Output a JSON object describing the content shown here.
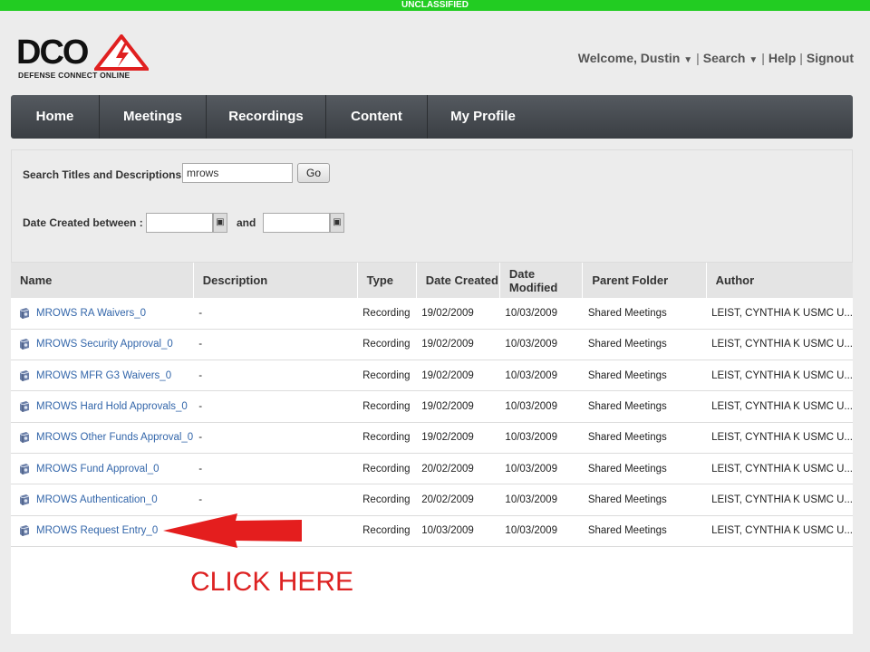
{
  "classification": "UNCLASSIFIED",
  "logo": {
    "title": "DCO",
    "subtitle": "DEFENSE CONNECT ONLINE"
  },
  "topnav": {
    "welcome": "Welcome, Dustin",
    "search": "Search",
    "help": "Help",
    "signout": "Signout"
  },
  "navbar": [
    {
      "label": "Home"
    },
    {
      "label": "Meetings"
    },
    {
      "label": "Recordings"
    },
    {
      "label": "Content"
    },
    {
      "label": "My Profile"
    }
  ],
  "search": {
    "titles_label": "Search Titles and Descriptions :",
    "query_value": "mrows",
    "go_label": "Go",
    "date_label": "Date Created between :",
    "and_label": "and"
  },
  "table": {
    "headers": [
      "Name",
      "Description",
      "Type",
      "Date Created",
      "Date Modified",
      "Parent Folder",
      "Author"
    ],
    "rows": [
      {
        "name": "MROWS RA Waivers_0",
        "description": "-",
        "type": "Recording",
        "created": "19/02/2009",
        "modified": "10/03/2009",
        "folder": "Shared Meetings",
        "author": "LEIST, CYNTHIA K USMC U..."
      },
      {
        "name": "MROWS Security Approval_0",
        "description": "-",
        "type": "Recording",
        "created": "19/02/2009",
        "modified": "10/03/2009",
        "folder": "Shared Meetings",
        "author": "LEIST, CYNTHIA K USMC U..."
      },
      {
        "name": "MROWS MFR G3 Waivers_0",
        "description": "-",
        "type": "Recording",
        "created": "19/02/2009",
        "modified": "10/03/2009",
        "folder": "Shared Meetings",
        "author": "LEIST, CYNTHIA K USMC U..."
      },
      {
        "name": "MROWS Hard Hold Approvals_0",
        "description": "-",
        "type": "Recording",
        "created": "19/02/2009",
        "modified": "10/03/2009",
        "folder": "Shared Meetings",
        "author": "LEIST, CYNTHIA K USMC U..."
      },
      {
        "name": "MROWS Other Funds Approval_0",
        "description": "-",
        "type": "Recording",
        "created": "19/02/2009",
        "modified": "10/03/2009",
        "folder": "Shared Meetings",
        "author": "LEIST, CYNTHIA K USMC U..."
      },
      {
        "name": "MROWS Fund Approval_0",
        "description": "-",
        "type": "Recording",
        "created": "20/02/2009",
        "modified": "10/03/2009",
        "folder": "Shared Meetings",
        "author": "LEIST, CYNTHIA K USMC U..."
      },
      {
        "name": "MROWS Authentication_0",
        "description": "-",
        "type": "Recording",
        "created": "20/02/2009",
        "modified": "10/03/2009",
        "folder": "Shared Meetings",
        "author": "LEIST, CYNTHIA K USMC U..."
      },
      {
        "name": "MROWS Request Entry_0",
        "description": "",
        "type": "Recording",
        "created": "10/03/2009",
        "modified": "10/03/2009",
        "folder": "Shared Meetings",
        "author": "LEIST, CYNTHIA K USMC U..."
      }
    ]
  },
  "annotation": {
    "text": "CLICK HERE"
  },
  "colors": {
    "link": "#3366aa",
    "annotation": "#dd2222",
    "classbar": "#22cc22"
  }
}
